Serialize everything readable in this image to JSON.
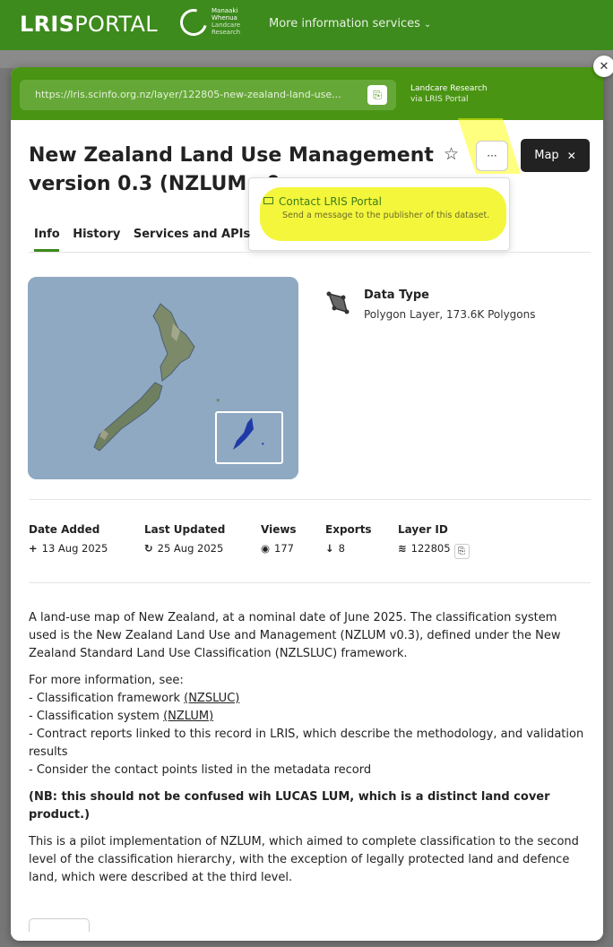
{
  "site": {
    "logo_bold": "LRIS",
    "logo_rest": "PORTAL",
    "partner_logo": [
      "Manaaki",
      "Whenua",
      "Landcare",
      "Research"
    ],
    "more_info_label": "More information services"
  },
  "modal": {
    "url": "https://lris.scinfo.org.nz/layer/122805-new-zealand-land-use...",
    "publisher": "Landcare Research",
    "publisher_via": "via LRIS Portal",
    "title": "New Zealand Land Use Management version 0.3 (NZLUM v0",
    "map_button_label": "Map",
    "more_button_label": "···",
    "dropdown": {
      "item_title": "Contact LRIS Portal",
      "item_subtitle": "Send a message to the publisher of this dataset."
    },
    "tabs": [
      "Info",
      "History",
      "Services and APIs"
    ],
    "data_type_label": "Data Type",
    "data_type_value": "Polygon Layer, 173.6K Polygons",
    "stats": [
      {
        "label": "Date Added",
        "icon": "plus-icon",
        "glyph": "+",
        "value": "13 Aug 2025"
      },
      {
        "label": "Last Updated",
        "icon": "history-icon",
        "glyph": "↻",
        "value": "25 Aug 2025"
      },
      {
        "label": "Views",
        "icon": "eye-icon",
        "glyph": "◉",
        "value": "177"
      },
      {
        "label": "Exports",
        "icon": "arrow-down-icon",
        "glyph": "↓",
        "value": "8"
      },
      {
        "label": "Layer ID",
        "icon": "layers-icon",
        "glyph": "≋",
        "value": "122805"
      }
    ],
    "description": {
      "p1": "A land-use map of New Zealand, at a nominal date of June 2025. The classification system used is the New Zealand Land Use and Management (NZLUM v0.3), defined under the New Zealand Standard Land Use Classification (NZLSLUC) framework.",
      "more_info_intro": "For more information, see:",
      "bullet1_prefix": "- Classification framework ",
      "bullet1_link": "(NZSLUC)",
      "bullet2_prefix": "- Classification system ",
      "bullet2_link": "(NZLUM)",
      "bullet3": "- Contract reports linked to this record in LRIS, which describe the methodology, and validation results",
      "bullet4": "- Consider the contact points listed in the metadata record",
      "note": "(NB: this should not be confused wih LUCAS LUM, which is a distinct land cover product.)",
      "p3": "This is a pilot implementation of NZLUM, which aimed to complete classification to the second level of the classification hierarchy, with the exception of legally protected land and defence land, which were described at the third level."
    }
  },
  "colors": {
    "brand_green": "#3d8a1d",
    "header_green": "#4a9414",
    "highlight_yellow": "#f4f63c"
  }
}
